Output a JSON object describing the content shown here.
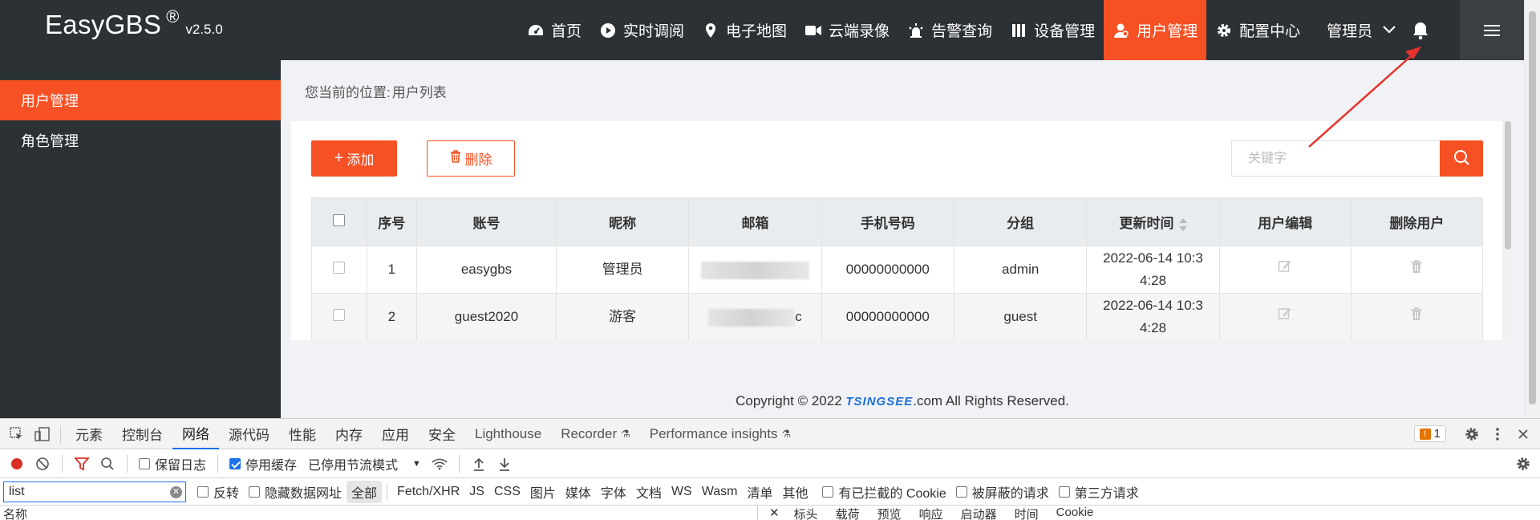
{
  "header": {
    "brand": "EasyGBS",
    "reg": "®",
    "version": "v2.5.0",
    "nav": [
      {
        "label": "首页",
        "icon": "dashboard-icon",
        "active": false
      },
      {
        "label": "实时调阅",
        "icon": "play-circle-icon",
        "active": false
      },
      {
        "label": "电子地图",
        "icon": "map-pin-icon",
        "active": false
      },
      {
        "label": "云端录像",
        "icon": "video-camera-icon",
        "active": false
      },
      {
        "label": "告警查询",
        "icon": "alarm-light-icon",
        "active": false
      },
      {
        "label": "设备管理",
        "icon": "server-icon",
        "active": false
      },
      {
        "label": "用户管理",
        "icon": "user-icon",
        "active": true
      },
      {
        "label": "配置中心",
        "icon": "gear-icon",
        "active": false
      }
    ],
    "user": "管理员"
  },
  "sidebar": {
    "items": [
      {
        "label": "用户管理",
        "active": true
      },
      {
        "label": "角色管理",
        "active": false
      }
    ]
  },
  "breadcrumb": {
    "prefix": "您当前的位置:",
    "current": "用户列表"
  },
  "toolbar": {
    "add_label": "添加",
    "delete_label": "删除",
    "search_placeholder": "关键字"
  },
  "table": {
    "columns": [
      "序号",
      "账号",
      "昵称",
      "邮箱",
      "手机号码",
      "分组",
      "更新时间",
      "用户编辑",
      "删除用户"
    ],
    "rows": [
      {
        "index": "1",
        "account": "easygbs",
        "nickname": "管理员",
        "email_visible": "",
        "phone": "00000000000",
        "group": "admin",
        "updated_line1": "2022-06-14 10:3",
        "updated_line2": "4:28"
      },
      {
        "index": "2",
        "account": "guest2020",
        "nickname": "游客",
        "email_visible": "c",
        "phone": "00000000000",
        "group": "guest",
        "updated_line1": "2022-06-14 10:3",
        "updated_line2": "4:28"
      }
    ]
  },
  "footer": {
    "prefix": "Copyright © 2022 ",
    "brand": "TSINGSEE",
    "suffix": ".com All Rights Reserved."
  },
  "devtools": {
    "tabs": [
      "元素",
      "控制台",
      "网络",
      "源代码",
      "性能",
      "内存",
      "应用",
      "安全",
      "Lighthouse",
      "Recorder",
      "Performance insights"
    ],
    "active_tab": "网络",
    "issues_count": "1",
    "toolbar": {
      "preserve_log": "保留日志",
      "disable_cache": "停用缓存",
      "throttle": "已停用节流模式"
    },
    "filter": {
      "value": "list",
      "invert": "反转",
      "hide_data_urls": "隐藏数据网址",
      "types": [
        "全部",
        "Fetch/XHR",
        "JS",
        "CSS",
        "图片",
        "媒体",
        "字体",
        "文档",
        "WS",
        "Wasm",
        "清单",
        "其他"
      ],
      "blocked_cookies": "有已拦截的 Cookie",
      "blocked_requests": "被屏蔽的请求",
      "third_party": "第三方请求"
    },
    "bottom": {
      "name_col": "名称",
      "detail_tabs": [
        "标头",
        "载荷",
        "预览",
        "响应",
        "启动器",
        "时间",
        "Cookie"
      ]
    }
  },
  "colors": {
    "accent": "#f65124",
    "header_bg": "#2c3135",
    "devtools_blue": "#1a73e8"
  }
}
